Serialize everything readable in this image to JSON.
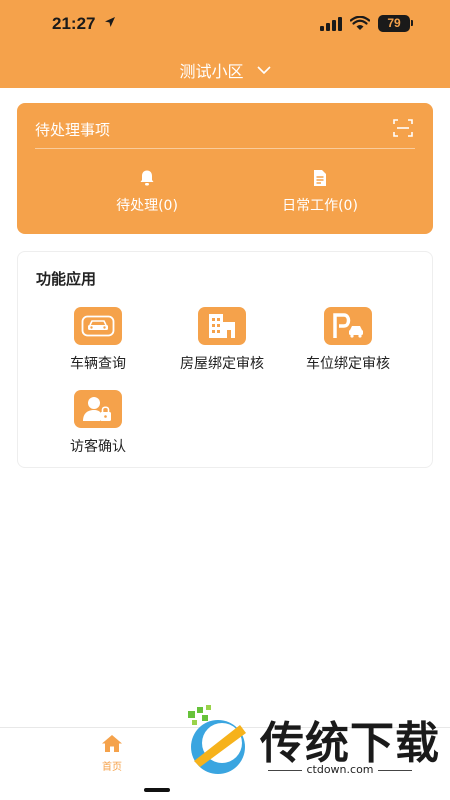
{
  "status_bar": {
    "time": "21:27",
    "battery": "79"
  },
  "header": {
    "community": "测试小区"
  },
  "pending": {
    "title": "待处理事项",
    "items": [
      {
        "label": "待处理(0)",
        "icon": "bell-icon"
      },
      {
        "label": "日常工作(0)",
        "icon": "document-icon"
      }
    ]
  },
  "functions": {
    "title": "功能应用",
    "items": [
      {
        "label": "车辆查询",
        "icon": "car-icon"
      },
      {
        "label": "房屋绑定审核",
        "icon": "building-icon"
      },
      {
        "label": "车位绑定审核",
        "icon": "parking-icon"
      },
      {
        "label": "访客确认",
        "icon": "visitor-lock-icon"
      }
    ]
  },
  "tabbar": {
    "home_label": "首页"
  },
  "watermark": {
    "brand": "传统下载",
    "url": "ctdown.com"
  },
  "colors": {
    "accent": "#f5a24b",
    "text": "#222222",
    "card_border": "#eeeeee"
  }
}
